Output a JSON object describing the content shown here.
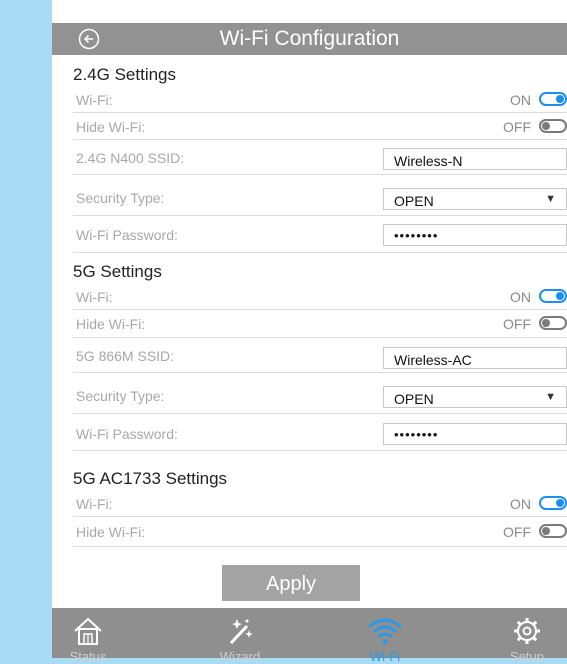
{
  "header": {
    "title": "Wi-Fi Configuration",
    "back_icon": "back-arrow-icon"
  },
  "sections": [
    {
      "title": "2.4G Settings",
      "wifi": {
        "label": "Wi-Fi:",
        "state": "ON"
      },
      "hide": {
        "label": "Hide Wi-Fi:",
        "state": "OFF"
      },
      "ssid": {
        "label": "2.4G N400 SSID:",
        "value": "Wireless-N"
      },
      "security": {
        "label": "Security Type:",
        "value": "OPEN"
      },
      "password": {
        "label": "Wi-Fi Password:",
        "value": "••••••••"
      }
    },
    {
      "title": "5G Settings",
      "wifi": {
        "label": "Wi-Fi:",
        "state": "ON"
      },
      "hide": {
        "label": "Hide Wi-Fi:",
        "state": "OFF"
      },
      "ssid": {
        "label": "5G 866M SSID:",
        "value": "Wireless-AC"
      },
      "security": {
        "label": "Security Type:",
        "value": "OPEN"
      },
      "password": {
        "label": "Wi-Fi Password:",
        "value": "••••••••"
      }
    },
    {
      "title": "5G AC1733 Settings",
      "wifi": {
        "label": "Wi-Fi:",
        "state": "ON"
      },
      "hide": {
        "label": "Hide Wi-Fi:",
        "state": "OFF"
      }
    }
  ],
  "apply_label": "Apply",
  "nav": [
    {
      "label": "Status",
      "icon": "home-icon"
    },
    {
      "label": "Wizard",
      "icon": "magic-wand-icon"
    },
    {
      "label": "Wi-Fi",
      "icon": "wifi-icon"
    },
    {
      "label": "Setup",
      "icon": "gear-icon"
    }
  ],
  "colors": {
    "accent": "#1c8ef0",
    "header": "#929292",
    "background": "#a8dcf4"
  }
}
